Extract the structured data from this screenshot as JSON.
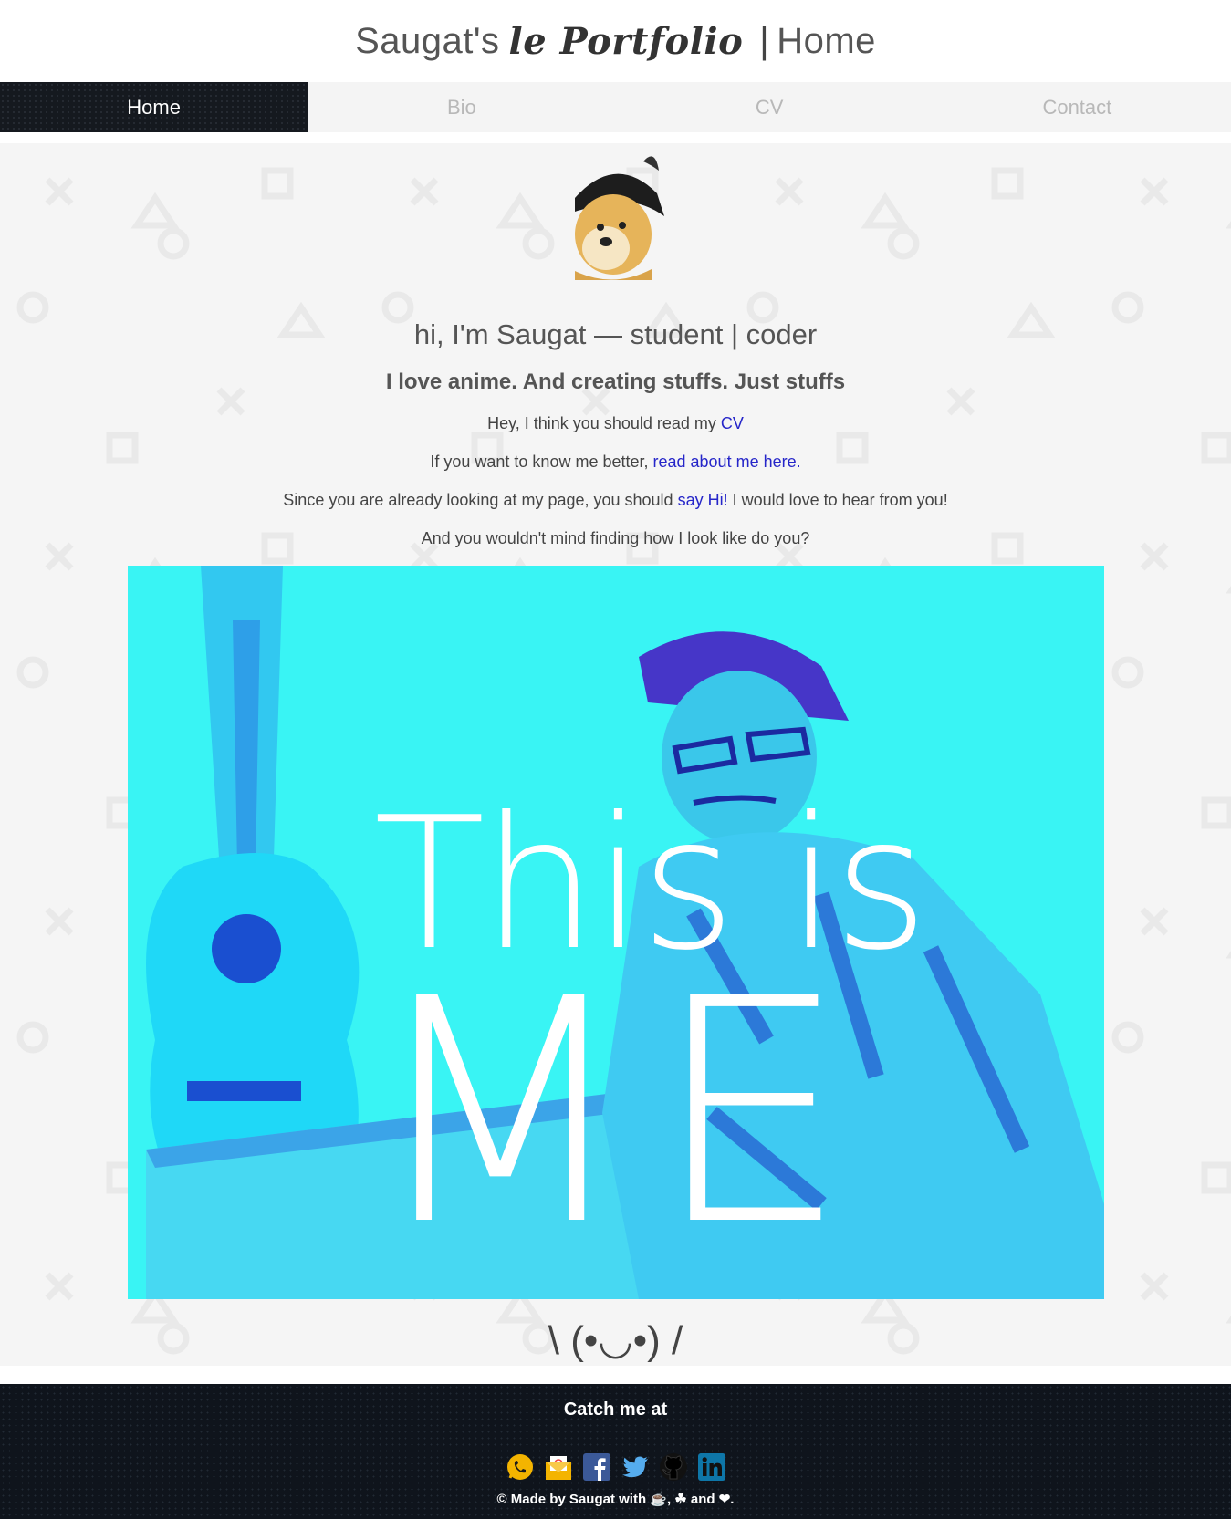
{
  "header": {
    "title_prefix": "Saugat's",
    "title_brand": "le Portfolio",
    "title_sep": "|",
    "title_suffix": "Home"
  },
  "nav": [
    {
      "label": "Home",
      "active": true
    },
    {
      "label": "Bio",
      "active": false
    },
    {
      "label": "CV",
      "active": false
    },
    {
      "label": "Contact",
      "active": false
    }
  ],
  "main": {
    "headline": "hi, I'm Saugat — student | coder",
    "subhead": "I love anime. And creating stuffs. Just stuffs",
    "line1_text": "Hey, I think you should read my ",
    "line1_link": "CV",
    "line2_text": "If you want to know me better, ",
    "line2_link": "read about me here.",
    "line3_text_a": "Since you are already looking at my page, you should ",
    "line3_link": "say Hi!",
    "line3_text_b": " I would love to hear from you!",
    "line4_text": "And you wouldn't mind finding how I look like do you?",
    "photo_text_1": "This is",
    "photo_text_2": "ME",
    "kaomoji": "\\ (•◡•) /"
  },
  "footer": {
    "title": "Catch me at",
    "social_icons": [
      "whatsapp-icon",
      "email-icon",
      "facebook-icon",
      "twitter-icon",
      "github-icon",
      "linkedin-icon"
    ],
    "copyright": "© Made by Saugat with ☕, ☘ and ❤."
  },
  "colors": {
    "nav_active_bg": "#15191f",
    "link": "#2626c9",
    "photo_bg": "#39f4f4",
    "footer_bg": "#0f141c"
  }
}
